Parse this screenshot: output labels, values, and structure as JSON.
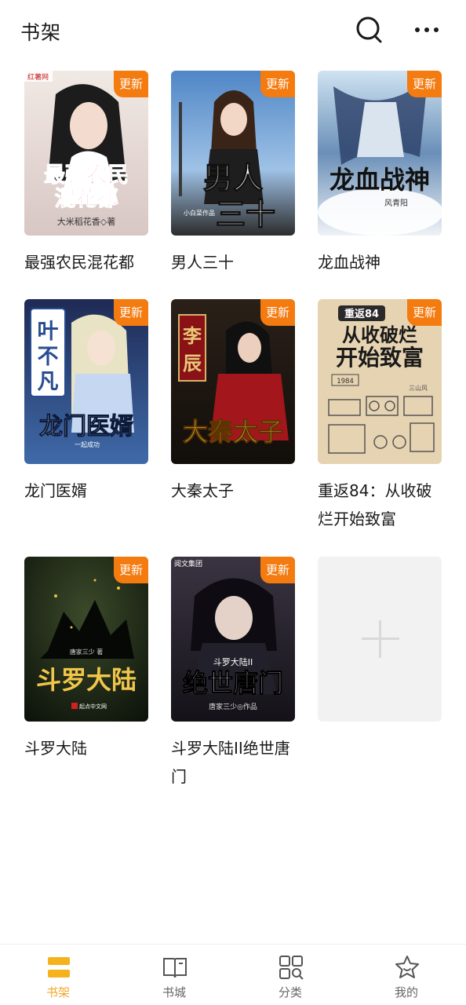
{
  "header": {
    "title": "书架",
    "icons": [
      "search-icon",
      "more-icon"
    ]
  },
  "badge_label": "更新",
  "accent_color": "#f47b0f",
  "active_tab_color": "#f5a623",
  "books": [
    {
      "title": "最强农民混花都",
      "has_update": true,
      "cover_text": "最强农民混花都",
      "cover_publisher": "红薯网",
      "cover_author": "大米稻花香◇著"
    },
    {
      "title": "男人三十",
      "has_update": true,
      "cover_text": "男人三十",
      "cover_author": "小白菜作品"
    },
    {
      "title": "龙血战神",
      "has_update": true,
      "cover_text": "龙血战神",
      "cover_author": "风青阳"
    },
    {
      "title": "龙门医婿",
      "has_update": true,
      "cover_text": "龙门医婿",
      "cover_subtext": "叶不凡",
      "cover_author": "一起成功"
    },
    {
      "title": "大秦太子",
      "has_update": true,
      "cover_text": "大秦太子",
      "cover_subtext": "李辰"
    },
    {
      "title": "重返84：从收破烂开始致富",
      "has_update": true,
      "cover_text": "从收破烂开始致富",
      "cover_subtext": "重返84",
      "cover_year": "1984",
      "cover_author": "三山风"
    },
    {
      "title": "斗罗大陆",
      "has_update": true,
      "cover_text": "斗罗大陆",
      "cover_author": "唐家三少 著",
      "cover_publisher": "起点中文网"
    },
    {
      "title": "斗罗大陆II绝世唐门",
      "has_update": true,
      "cover_text": "绝世唐门",
      "cover_subtext": "斗罗大陆II",
      "cover_author": "唐家三少◎作品",
      "cover_publisher": "阅文集团"
    }
  ],
  "tabs": [
    {
      "label": "书架",
      "icon": "bookshelf-icon",
      "active": true
    },
    {
      "label": "书城",
      "icon": "book-open-icon",
      "active": false
    },
    {
      "label": "分类",
      "icon": "grid-search-icon",
      "active": false
    },
    {
      "label": "我的",
      "icon": "star-face-icon",
      "active": false
    }
  ]
}
